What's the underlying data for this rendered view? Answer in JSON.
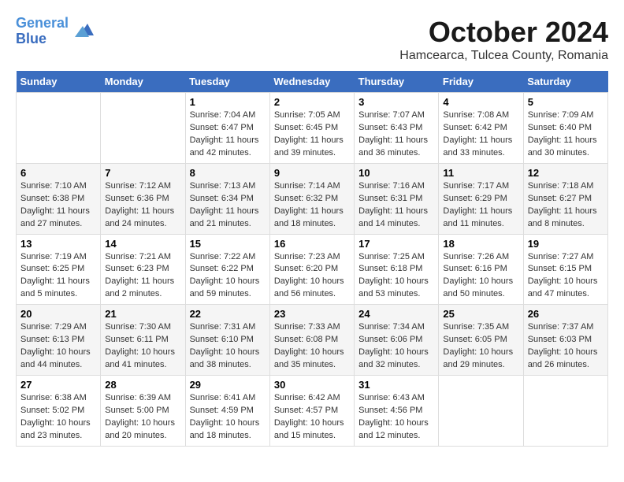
{
  "header": {
    "logo_line1": "General",
    "logo_line2": "Blue",
    "month": "October 2024",
    "location": "Hamcearca, Tulcea County, Romania"
  },
  "days_of_week": [
    "Sunday",
    "Monday",
    "Tuesday",
    "Wednesday",
    "Thursday",
    "Friday",
    "Saturday"
  ],
  "weeks": [
    [
      {
        "day": "",
        "info": ""
      },
      {
        "day": "",
        "info": ""
      },
      {
        "day": "1",
        "info": "Sunrise: 7:04 AM\nSunset: 6:47 PM\nDaylight: 11 hours and 42 minutes."
      },
      {
        "day": "2",
        "info": "Sunrise: 7:05 AM\nSunset: 6:45 PM\nDaylight: 11 hours and 39 minutes."
      },
      {
        "day": "3",
        "info": "Sunrise: 7:07 AM\nSunset: 6:43 PM\nDaylight: 11 hours and 36 minutes."
      },
      {
        "day": "4",
        "info": "Sunrise: 7:08 AM\nSunset: 6:42 PM\nDaylight: 11 hours and 33 minutes."
      },
      {
        "day": "5",
        "info": "Sunrise: 7:09 AM\nSunset: 6:40 PM\nDaylight: 11 hours and 30 minutes."
      }
    ],
    [
      {
        "day": "6",
        "info": "Sunrise: 7:10 AM\nSunset: 6:38 PM\nDaylight: 11 hours and 27 minutes."
      },
      {
        "day": "7",
        "info": "Sunrise: 7:12 AM\nSunset: 6:36 PM\nDaylight: 11 hours and 24 minutes."
      },
      {
        "day": "8",
        "info": "Sunrise: 7:13 AM\nSunset: 6:34 PM\nDaylight: 11 hours and 21 minutes."
      },
      {
        "day": "9",
        "info": "Sunrise: 7:14 AM\nSunset: 6:32 PM\nDaylight: 11 hours and 18 minutes."
      },
      {
        "day": "10",
        "info": "Sunrise: 7:16 AM\nSunset: 6:31 PM\nDaylight: 11 hours and 14 minutes."
      },
      {
        "day": "11",
        "info": "Sunrise: 7:17 AM\nSunset: 6:29 PM\nDaylight: 11 hours and 11 minutes."
      },
      {
        "day": "12",
        "info": "Sunrise: 7:18 AM\nSunset: 6:27 PM\nDaylight: 11 hours and 8 minutes."
      }
    ],
    [
      {
        "day": "13",
        "info": "Sunrise: 7:19 AM\nSunset: 6:25 PM\nDaylight: 11 hours and 5 minutes."
      },
      {
        "day": "14",
        "info": "Sunrise: 7:21 AM\nSunset: 6:23 PM\nDaylight: 11 hours and 2 minutes."
      },
      {
        "day": "15",
        "info": "Sunrise: 7:22 AM\nSunset: 6:22 PM\nDaylight: 10 hours and 59 minutes."
      },
      {
        "day": "16",
        "info": "Sunrise: 7:23 AM\nSunset: 6:20 PM\nDaylight: 10 hours and 56 minutes."
      },
      {
        "day": "17",
        "info": "Sunrise: 7:25 AM\nSunset: 6:18 PM\nDaylight: 10 hours and 53 minutes."
      },
      {
        "day": "18",
        "info": "Sunrise: 7:26 AM\nSunset: 6:16 PM\nDaylight: 10 hours and 50 minutes."
      },
      {
        "day": "19",
        "info": "Sunrise: 7:27 AM\nSunset: 6:15 PM\nDaylight: 10 hours and 47 minutes."
      }
    ],
    [
      {
        "day": "20",
        "info": "Sunrise: 7:29 AM\nSunset: 6:13 PM\nDaylight: 10 hours and 44 minutes."
      },
      {
        "day": "21",
        "info": "Sunrise: 7:30 AM\nSunset: 6:11 PM\nDaylight: 10 hours and 41 minutes."
      },
      {
        "day": "22",
        "info": "Sunrise: 7:31 AM\nSunset: 6:10 PM\nDaylight: 10 hours and 38 minutes."
      },
      {
        "day": "23",
        "info": "Sunrise: 7:33 AM\nSunset: 6:08 PM\nDaylight: 10 hours and 35 minutes."
      },
      {
        "day": "24",
        "info": "Sunrise: 7:34 AM\nSunset: 6:06 PM\nDaylight: 10 hours and 32 minutes."
      },
      {
        "day": "25",
        "info": "Sunrise: 7:35 AM\nSunset: 6:05 PM\nDaylight: 10 hours and 29 minutes."
      },
      {
        "day": "26",
        "info": "Sunrise: 7:37 AM\nSunset: 6:03 PM\nDaylight: 10 hours and 26 minutes."
      }
    ],
    [
      {
        "day": "27",
        "info": "Sunrise: 6:38 AM\nSunset: 5:02 PM\nDaylight: 10 hours and 23 minutes."
      },
      {
        "day": "28",
        "info": "Sunrise: 6:39 AM\nSunset: 5:00 PM\nDaylight: 10 hours and 20 minutes."
      },
      {
        "day": "29",
        "info": "Sunrise: 6:41 AM\nSunset: 4:59 PM\nDaylight: 10 hours and 18 minutes."
      },
      {
        "day": "30",
        "info": "Sunrise: 6:42 AM\nSunset: 4:57 PM\nDaylight: 10 hours and 15 minutes."
      },
      {
        "day": "31",
        "info": "Sunrise: 6:43 AM\nSunset: 4:56 PM\nDaylight: 10 hours and 12 minutes."
      },
      {
        "day": "",
        "info": ""
      },
      {
        "day": "",
        "info": ""
      }
    ]
  ]
}
